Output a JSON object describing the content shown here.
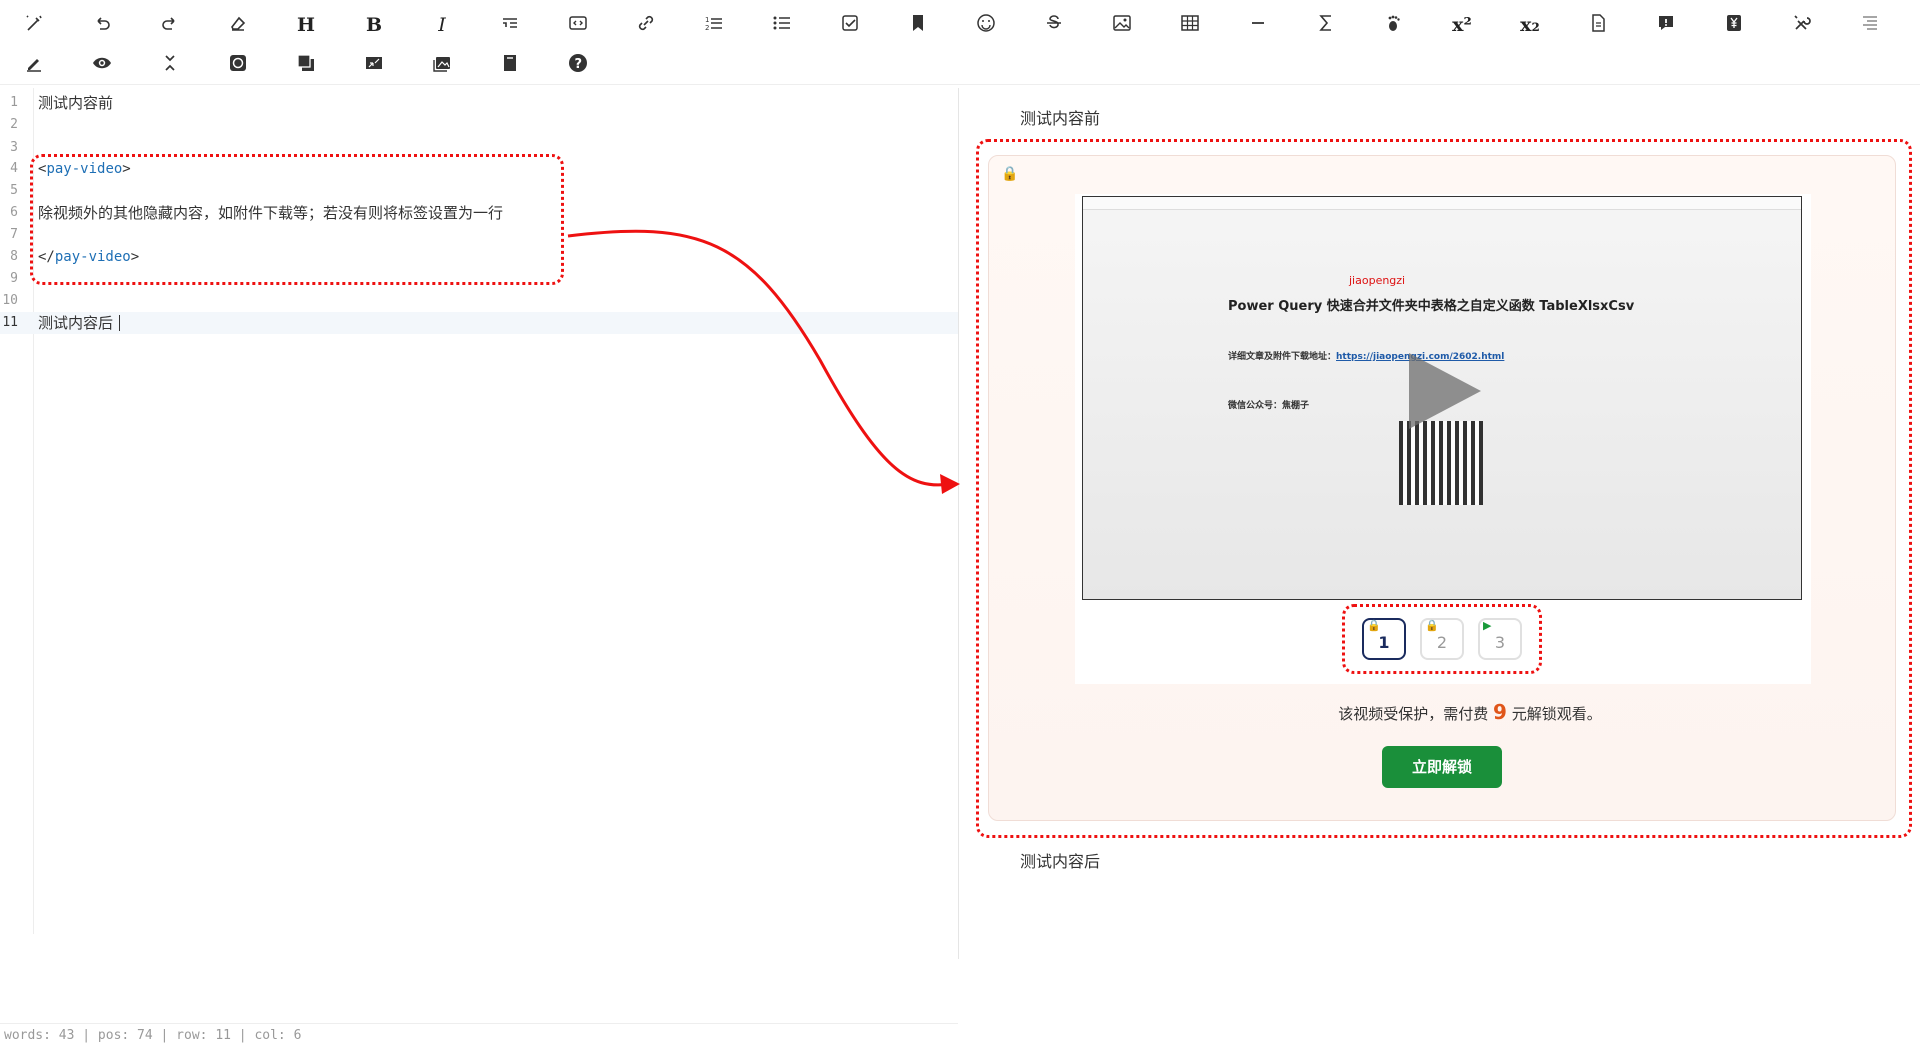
{
  "toolbar": {
    "row1": [
      "magic-pen-icon",
      "undo-icon",
      "redo-icon",
      "eraser-icon",
      "heading-icon",
      "bold-icon",
      "italic-icon",
      "quote-icon",
      "code-block-icon",
      "link-icon",
      "ordered-list-icon",
      "unordered-list-icon",
      "checklist-icon",
      "bookmark-icon",
      "emoji-icon",
      "strikethrough-icon",
      "image-icon",
      "table-icon",
      "horizontal-rule-icon",
      "formula-icon",
      "footnote-icon",
      "superscript-icon",
      "subscript-icon",
      "document-icon",
      "alert-icon",
      "yuan-icon",
      "tools-icon",
      "align-icon"
    ],
    "row2": [
      "pen-icon",
      "eye-icon",
      "collapse-icon",
      "refresh-icon",
      "layers-icon",
      "shrink-icon",
      "gallery-icon",
      "bookmark-book-icon",
      "help-icon"
    ],
    "heading_label": "H",
    "bold_label": "B",
    "italic_label": "I",
    "superscript_label": "x²",
    "subscript_label": "x₂"
  },
  "editor": {
    "lines": [
      {
        "num": "1",
        "text": "测试内容前"
      },
      {
        "num": "2",
        "text": ""
      },
      {
        "num": "3",
        "text": ""
      },
      {
        "num": "4",
        "open": "<",
        "tag": "pay-video",
        "close": ">"
      },
      {
        "num": "5",
        "text": ""
      },
      {
        "num": "6",
        "text": "除视频外的其他隐藏内容，如附件下载等；若没有则将标签设置为一行"
      },
      {
        "num": "7",
        "text": ""
      },
      {
        "num": "8",
        "open": "</",
        "tag": "pay-video",
        "close": ">"
      },
      {
        "num": "9",
        "text": ""
      },
      {
        "num": "10",
        "text": ""
      },
      {
        "num": "11",
        "text": "测试内容后"
      }
    ],
    "status": "words: 43 | pos: 74 | row: 11 | col: 6"
  },
  "preview": {
    "before_text": "测试内容前",
    "after_text": "测试内容后",
    "video": {
      "red_label": "jiaopengzi",
      "title": "Power Query 快速合并文件夹中表格之自定义函数 TableXlsxCsv",
      "detail_label": "详细文章及附件下载地址：",
      "detail_link": "https://jiaopengzi.com/2602.html",
      "wechat_label": "微信公众号：焦棚子"
    },
    "episodes": [
      {
        "num": "1",
        "state": "locked",
        "selected": true
      },
      {
        "num": "2",
        "state": "locked",
        "selected": false
      },
      {
        "num": "3",
        "state": "free",
        "selected": false
      }
    ],
    "notice_before": "该视频受保护，需付费",
    "price": "9",
    "notice_after": "元解锁观看。",
    "unlock_button": "立即解锁"
  },
  "colors": {
    "annotation": "#e11111",
    "tag_name": "#1e6fb5",
    "unlock_button": "#1a8f3a",
    "price": "#e0561a",
    "lock": "#e33333"
  }
}
